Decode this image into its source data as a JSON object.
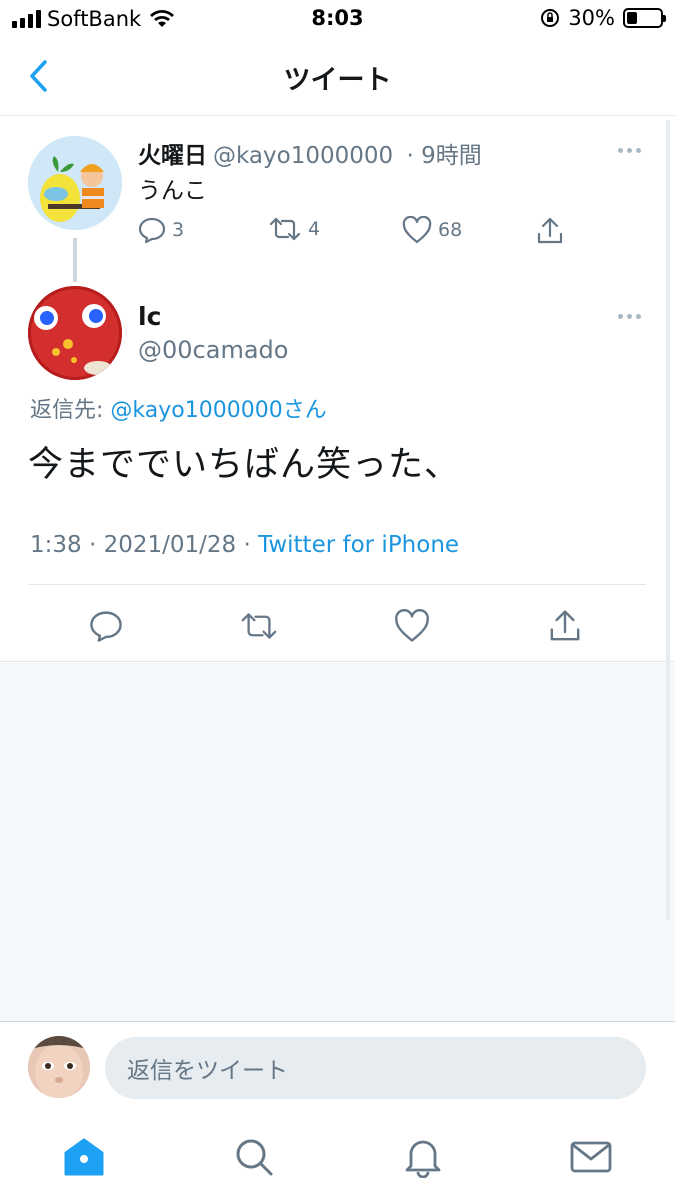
{
  "status_bar": {
    "carrier": "SoftBank",
    "time": "8:03",
    "battery_percent": "30%",
    "battery_level": 0.3,
    "signal_bars": 4,
    "icons": [
      "signal-icon",
      "wifi-icon",
      "orientation-lock-icon",
      "battery-icon"
    ]
  },
  "nav": {
    "title": "ツイート",
    "back_icon": "chevron-left-icon"
  },
  "parent_tweet": {
    "name": "火曜日",
    "handle": "@kayo1000000",
    "time": "· 9時間",
    "text": "うんこ",
    "replies": "3",
    "retweets": "4",
    "likes": "68"
  },
  "main_tweet": {
    "name": "lc",
    "handle": "@00camado",
    "reply_label": "返信先:",
    "reply_mention": "@kayo1000000さん",
    "text": "今まででいちばん笑った、",
    "timestamp": "1:38 · 2021/01/28 ·",
    "source": "Twitter for iPhone"
  },
  "composer": {
    "placeholder": "返信をツイート"
  },
  "tabbar": {
    "items": [
      "home-icon",
      "search-icon",
      "notifications-icon",
      "messages-icon"
    ],
    "active": "home-icon"
  },
  "colors": {
    "accent": "#1da1f2",
    "link": "#1b95e0",
    "secondary_text": "#657786",
    "icon_gray": "#657786",
    "background_empty": "#f5f8fa"
  }
}
